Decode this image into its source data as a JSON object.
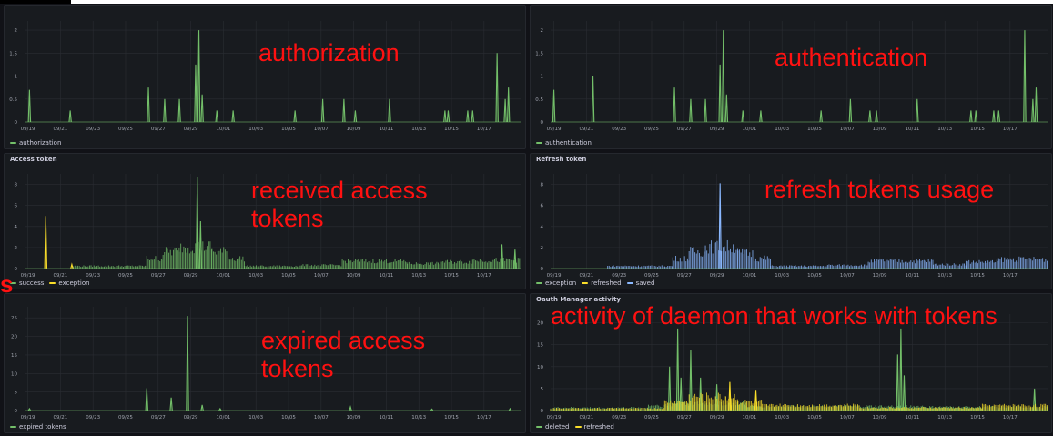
{
  "colors": {
    "green": "#73bf69",
    "yellow": "#fade2a",
    "blue": "#8ab8ff",
    "annotation": "#ff1111",
    "panel_bg": "#181b1f",
    "grid": "#2a2d33"
  },
  "side_mark": "s",
  "x_ticks": [
    "09/19",
    "09/21",
    "09/23",
    "09/25",
    "09/27",
    "09/29",
    "10/01",
    "10/03",
    "10/05",
    "10/07",
    "10/09",
    "10/11",
    "10/13",
    "10/15",
    "10/17"
  ],
  "panels": {
    "authorization": {
      "title": "",
      "annotation": "authorization",
      "legend": [
        {
          "label": "authorization",
          "color": "#73bf69"
        }
      ]
    },
    "authentication": {
      "title": "",
      "annotation": "authentication",
      "legend": [
        {
          "label": "authentication",
          "color": "#73bf69"
        }
      ]
    },
    "access_token": {
      "title": "Access token",
      "annotation": "received access tokens",
      "legend": [
        {
          "label": "success",
          "color": "#73bf69"
        },
        {
          "label": "exception",
          "color": "#fade2a"
        }
      ]
    },
    "refresh_token": {
      "title": "Refresh token",
      "annotation": "refresh tokens usage",
      "legend": [
        {
          "label": "exception",
          "color": "#73bf69"
        },
        {
          "label": "refreshed",
          "color": "#fade2a"
        },
        {
          "label": "saved",
          "color": "#8ab8ff"
        }
      ]
    },
    "expired": {
      "title": "",
      "annotation": "expired access tokens",
      "legend": [
        {
          "label": "expired tokens",
          "color": "#73bf69"
        }
      ]
    },
    "oauth_manager": {
      "title": "Oauth Manager activity",
      "annotation": "activity of daemon that works with tokens",
      "legend": [
        {
          "label": "deleted",
          "color": "#73bf69"
        },
        {
          "label": "refreshed",
          "color": "#fade2a"
        }
      ]
    }
  },
  "chart_data": [
    {
      "id": "authorization",
      "type": "line",
      "ylim": [
        0,
        2.2
      ],
      "yticks": [
        "0",
        "0.5",
        "1",
        "1.5",
        "2"
      ],
      "ytick_values": [
        0,
        0.5,
        1,
        1.5,
        2
      ],
      "x_range_days": [
        0,
        30.5
      ],
      "series": [
        {
          "name": "authorization",
          "color": "#73bf69",
          "spikes": [
            [
              0.3,
              0.7
            ],
            [
              2.8,
              0.25
            ],
            [
              7.6,
              0.75
            ],
            [
              8.6,
              0.5
            ],
            [
              9.5,
              0.5
            ],
            [
              10.5,
              1.25
            ],
            [
              10.7,
              2.0
            ],
            [
              10.9,
              0.6
            ],
            [
              11.8,
              0.25
            ],
            [
              12.8,
              0.25
            ],
            [
              16.6,
              0.25
            ],
            [
              18.3,
              0.5
            ],
            [
              19.6,
              0.5
            ],
            [
              20.3,
              0.25
            ],
            [
              22.4,
              0.5
            ],
            [
              25.8,
              0.25
            ],
            [
              26.0,
              0.25
            ],
            [
              27.2,
              0.25
            ],
            [
              27.5,
              0.25
            ],
            [
              29.0,
              1.5
            ],
            [
              29.5,
              0.5
            ],
            [
              29.7,
              0.75
            ]
          ]
        }
      ]
    },
    {
      "id": "authentication",
      "type": "line",
      "ylim": [
        0,
        2.2
      ],
      "yticks": [
        "0",
        "0.5",
        "1",
        "1.5",
        "2"
      ],
      "ytick_values": [
        0,
        0.5,
        1,
        1.5,
        2
      ],
      "x_range_days": [
        0,
        30.5
      ],
      "series": [
        {
          "name": "authentication",
          "color": "#73bf69",
          "spikes": [
            [
              0.2,
              0.7
            ],
            [
              2.6,
              1.0
            ],
            [
              7.6,
              0.75
            ],
            [
              8.6,
              0.5
            ],
            [
              9.5,
              0.5
            ],
            [
              10.4,
              1.25
            ],
            [
              10.6,
              2.0
            ],
            [
              10.8,
              0.6
            ],
            [
              11.8,
              0.25
            ],
            [
              12.9,
              0.25
            ],
            [
              16.6,
              0.25
            ],
            [
              18.4,
              0.5
            ],
            [
              19.6,
              0.25
            ],
            [
              20.0,
              0.25
            ],
            [
              22.5,
              0.5
            ],
            [
              25.8,
              0.25
            ],
            [
              26.1,
              0.25
            ],
            [
              27.2,
              0.25
            ],
            [
              27.5,
              0.25
            ],
            [
              29.1,
              2.0
            ],
            [
              29.6,
              0.5
            ],
            [
              29.8,
              0.75
            ]
          ]
        }
      ]
    },
    {
      "id": "access_token",
      "type": "line",
      "ylim": [
        0,
        9
      ],
      "yticks": [
        "0",
        "2",
        "4",
        "6",
        "8"
      ],
      "ytick_values": [
        0,
        2,
        4,
        6,
        8
      ],
      "x_range_days": [
        0,
        30.5
      ],
      "series": [
        {
          "name": "success",
          "color": "#73bf69",
          "bands": [
            [
              3.0,
              7.5,
              0.3
            ],
            [
              7.5,
              8.5,
              1.2
            ],
            [
              8.5,
              9.5,
              2.0
            ],
            [
              9.5,
              11.5,
              2.6
            ],
            [
              11.5,
              12.5,
              2.0
            ],
            [
              12.5,
              13.5,
              1.2
            ],
            [
              13.5,
              17.0,
              0.3
            ],
            [
              17.0,
              19.5,
              0.4
            ],
            [
              19.5,
              23.5,
              0.9
            ],
            [
              23.5,
              25.5,
              0.6
            ],
            [
              25.5,
              27.5,
              0.8
            ],
            [
              27.5,
              30.5,
              1.0
            ]
          ],
          "spikes": [
            [
              10.6,
              8.7
            ],
            [
              10.8,
              4.5
            ],
            [
              29.3,
              2.3
            ],
            [
              30.1,
              1.8
            ]
          ]
        },
        {
          "name": "exception",
          "color": "#fade2a",
          "spikes": [
            [
              1.3,
              5.0
            ],
            [
              2.9,
              0.4
            ]
          ]
        }
      ]
    },
    {
      "id": "refresh_token",
      "type": "line",
      "ylim": [
        0,
        9
      ],
      "yticks": [
        "0",
        "2",
        "4",
        "6",
        "8"
      ],
      "ytick_values": [
        0,
        2,
        4,
        6,
        8
      ],
      "x_range_days": [
        0,
        30.5
      ],
      "series": [
        {
          "name": "exception",
          "color": "#73bf69",
          "spikes": []
        },
        {
          "name": "refreshed",
          "color": "#fade2a",
          "spikes": []
        },
        {
          "name": "saved",
          "color": "#8ab8ff",
          "bands": [
            [
              3.5,
              7.5,
              0.3
            ],
            [
              7.5,
              8.5,
              1.2
            ],
            [
              8.5,
              9.5,
              2.0
            ],
            [
              9.5,
              11.5,
              2.6
            ],
            [
              11.5,
              12.5,
              1.8
            ],
            [
              12.5,
              13.5,
              1.2
            ],
            [
              13.5,
              17.0,
              0.3
            ],
            [
              17.0,
              19.5,
              0.4
            ],
            [
              19.5,
              23.5,
              0.9
            ],
            [
              23.5,
              25.5,
              0.5
            ],
            [
              25.5,
              27.5,
              0.8
            ],
            [
              27.5,
              30.5,
              1.1
            ]
          ],
          "spikes": [
            [
              10.4,
              8.1
            ]
          ]
        }
      ]
    },
    {
      "id": "expired",
      "type": "line",
      "ylim": [
        0,
        28
      ],
      "yticks": [
        "0",
        "5",
        "10",
        "15",
        "20",
        "25"
      ],
      "ytick_values": [
        0,
        5,
        10,
        15,
        20,
        25
      ],
      "x_range_days": [
        0,
        30.5
      ],
      "series": [
        {
          "name": "expired tokens",
          "color": "#73bf69",
          "spikes": [
            [
              0.3,
              0.5
            ],
            [
              7.5,
              6.0
            ],
            [
              9.0,
              3.5
            ],
            [
              10.0,
              25.5
            ],
            [
              10.9,
              1.5
            ],
            [
              12.0,
              0.5
            ],
            [
              20.0,
              1.0
            ],
            [
              25.0,
              0.4
            ],
            [
              29.8,
              0.5
            ]
          ]
        }
      ]
    },
    {
      "id": "oauth_manager",
      "type": "line",
      "ylim": [
        0,
        22
      ],
      "yticks": [
        "0",
        "5",
        "10",
        "15",
        "20"
      ],
      "ytick_values": [
        0,
        5,
        10,
        15,
        20
      ],
      "x_range_days": [
        0,
        30.5
      ],
      "series": [
        {
          "name": "deleted",
          "color": "#73bf69",
          "bands": [
            [
              0,
              6.0,
              0.8
            ],
            [
              6.0,
              7.5,
              1.5
            ],
            [
              7.5,
              12.0,
              2.0
            ],
            [
              12.0,
              19.5,
              1.2
            ],
            [
              19.5,
              23.0,
              1.2
            ],
            [
              23.0,
              30.5,
              1.0
            ]
          ],
          "spikes": [
            [
              7.3,
              10.0
            ],
            [
              7.8,
              18.7
            ],
            [
              8.0,
              7.5
            ],
            [
              8.6,
              13.7
            ],
            [
              9.2,
              7.5
            ],
            [
              10.2,
              6.0
            ],
            [
              21.3,
              12.8
            ],
            [
              21.5,
              18.7
            ],
            [
              21.7,
              8.0
            ],
            [
              29.7,
              5.0
            ]
          ]
        },
        {
          "name": "refreshed",
          "color": "#fade2a",
          "bands": [
            [
              0,
              7.0,
              0.6
            ],
            [
              7.0,
              8.5,
              2.5
            ],
            [
              8.5,
              11.5,
              4.0
            ],
            [
              11.5,
              13.0,
              2.5
            ],
            [
              13.0,
              19.0,
              1.5
            ],
            [
              19.0,
              26.5,
              0.8
            ],
            [
              26.5,
              30.5,
              1.5
            ]
          ],
          "spikes": [
            [
              11.0,
              6.5
            ],
            [
              12.6,
              4.5
            ]
          ]
        }
      ]
    }
  ]
}
